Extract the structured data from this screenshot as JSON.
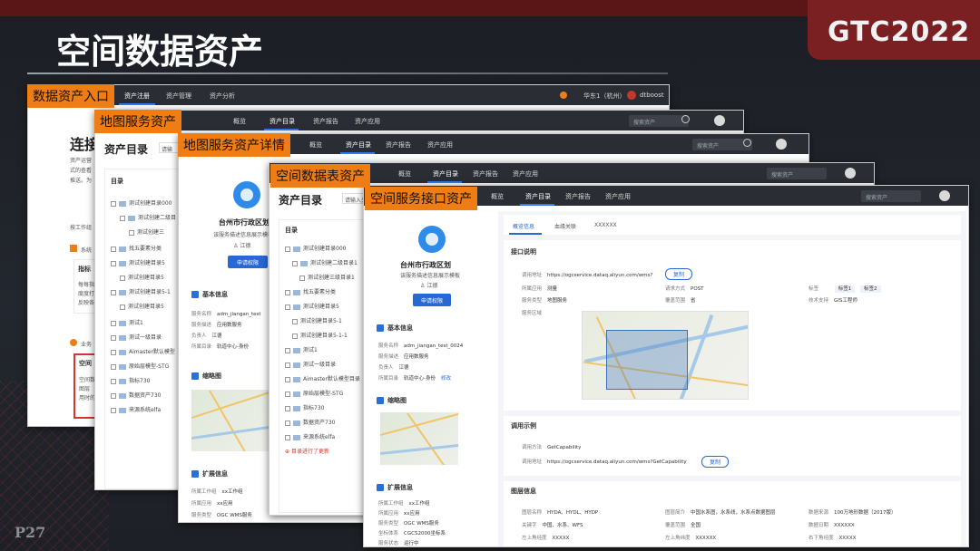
{
  "slide": {
    "title": "空间数据资产",
    "brand": "GTC2022",
    "page_number": "P27"
  },
  "tags": {
    "entry": "数据资产入口",
    "map_service": "地图服务资产",
    "map_detail": "地图服务资产详情",
    "table_asset": "空间数据表资产",
    "api_asset": "空间服务接口资产"
  },
  "win1": {
    "nav": [
      "资产注册",
      "资产管理",
      "资产分析"
    ],
    "region": "华东1（杭州）",
    "user": "dtboost",
    "heading": "连接",
    "intro": [
      "资产运营",
      "式的查看",
      "推送。为"
    ],
    "work": "按工作组",
    "system": "系统",
    "metric": "指标",
    "metric_lines": [
      "每每指标",
      "度度打...",
      "反映各..."
    ],
    "business": "业务",
    "space": "空间",
    "space_lines": [
      "空间数据",
      "图层",
      "用时的"
    ]
  },
  "win2": {
    "nav": [
      "概览",
      "资产目录",
      "资产报告",
      "资产应用"
    ],
    "search": "搜索资产",
    "page_title": "资产目录",
    "search2": "请输",
    "tree_title": "目录",
    "tree": [
      "测试创建目录000",
      "测试创建二级目",
      "测试创建三",
      "找五要素分类",
      "测试创建目录5",
      "测试创建目录5",
      "测试创建目录5-1",
      "测试创建目录5",
      "测试1",
      "测试一级目录",
      "Aimaster默认模型",
      "原始层模型-STG",
      "指标730",
      "数据资产730",
      "来源系统elfa"
    ]
  },
  "win3": {
    "nav": [
      "概览",
      "资产目录",
      "资产报告",
      "资产应用"
    ],
    "search": "搜索资产",
    "org": "台州市行政区划",
    "desc": "该服务描述信息展示模板",
    "owner": "江德",
    "apply": "申请权限",
    "basic_title": "基本信息",
    "basic": [
      [
        "服务名称",
        "adm_jiangan_test"
      ],
      [
        "服务描述",
        "应用数服务"
      ],
      [
        "负责人",
        "江德"
      ],
      [
        "所属目录",
        "轨道中心-身份"
      ]
    ],
    "thumb_title": "缩略图",
    "ext_title": "扩展信息",
    "ext": [
      [
        "所属工作组",
        "xx工作组"
      ],
      [
        "所属应用",
        "xx应用"
      ],
      [
        "服务类型",
        "OGC WMS服务"
      ]
    ]
  },
  "win4": {
    "nav": [
      "概览",
      "资产目录",
      "资产报告",
      "资产应用"
    ],
    "search": "搜索资产",
    "page_title": "资产目录",
    "search2": "请输入关键字",
    "tree_title": "目录",
    "tree": [
      "测试创建目录000",
      "测试创建二级目录1",
      "测试创建三级目录1",
      "找五要素分类",
      "测试创建目录5",
      "测试创建目录5-1",
      "测试创建目录5-1-1",
      "测试1",
      "测试一级目录",
      "Aimaster默认模型目录",
      "原始层模型-STG",
      "指标730",
      "数据资产730",
      "来源系统elfa"
    ],
    "add_dir": "目录进行了更新"
  },
  "win5": {
    "nav": [
      "概览",
      "资产目录",
      "资产报告",
      "资产应用"
    ],
    "search": "搜索资产",
    "org": "台州市行政区划",
    "desc": "该服务描述信息展示模板",
    "owner": "江德",
    "apply": "申请权限",
    "basic_title": "基本信息",
    "basic": [
      [
        "服务名称",
        "adm_jiangan_test_0024"
      ],
      [
        "服务描述",
        "应用数服务"
      ],
      [
        "负责人",
        "江德"
      ],
      [
        "所属目录",
        "轨道中心-身份"
      ]
    ],
    "edit": "修改",
    "thumb_title": "缩略图",
    "ext_title": "扩展信息",
    "ext": [
      [
        "所属工作组",
        "xx工作组"
      ],
      [
        "所属应用",
        "xx应用"
      ],
      [
        "服务类型",
        "OGC WMS服务"
      ],
      [
        "坐标体系",
        "CGCS2000坐标系"
      ],
      [
        "服务状态",
        "运行中"
      ]
    ],
    "tabs": [
      "概览信息",
      "血缘关联",
      "XXXXXX"
    ],
    "api_title": "接口说明",
    "api": {
      "url_label": "调用地址",
      "url": "https://ogcservice.dataq.aliyun.com/wms?",
      "copy": "复制",
      "scope_label": "所属应用",
      "scope": "测量",
      "method_label": "请求方式",
      "method": "POST",
      "tag_label": "标签",
      "tags": [
        "标签1",
        "标签2"
      ],
      "type_label": "服务类型",
      "type": "地图服务",
      "range_label": "覆盖范围",
      "range": "省",
      "tech_label": "技术支持",
      "tech": "GIS工程师",
      "area_label": "服务区域"
    },
    "example_title": "调用示例",
    "example": {
      "method_label": "调用方法",
      "method": "GetCapability",
      "url_label": "调用地址",
      "url": "https://ogcservice.dataq.aliyun.com/wms?GetCapability",
      "copy": "复制"
    },
    "layer_title": "图层信息",
    "layer": [
      [
        "图层名称",
        "HYDA、HYDL、HYDP",
        "图层简介",
        "中国水系图，水系线，水系点数据图层",
        "数据来源",
        "100万地形数据（2017版）"
      ],
      [
        "关键字",
        "中国、水系、WFS",
        "覆盖范围",
        "全国",
        "数据日期",
        "XXXXXX"
      ],
      [
        "左上角经度",
        "XXXXX",
        "左上角纬度",
        "XXXXXX",
        "右下角经度",
        "XXXXX"
      ]
    ]
  }
}
